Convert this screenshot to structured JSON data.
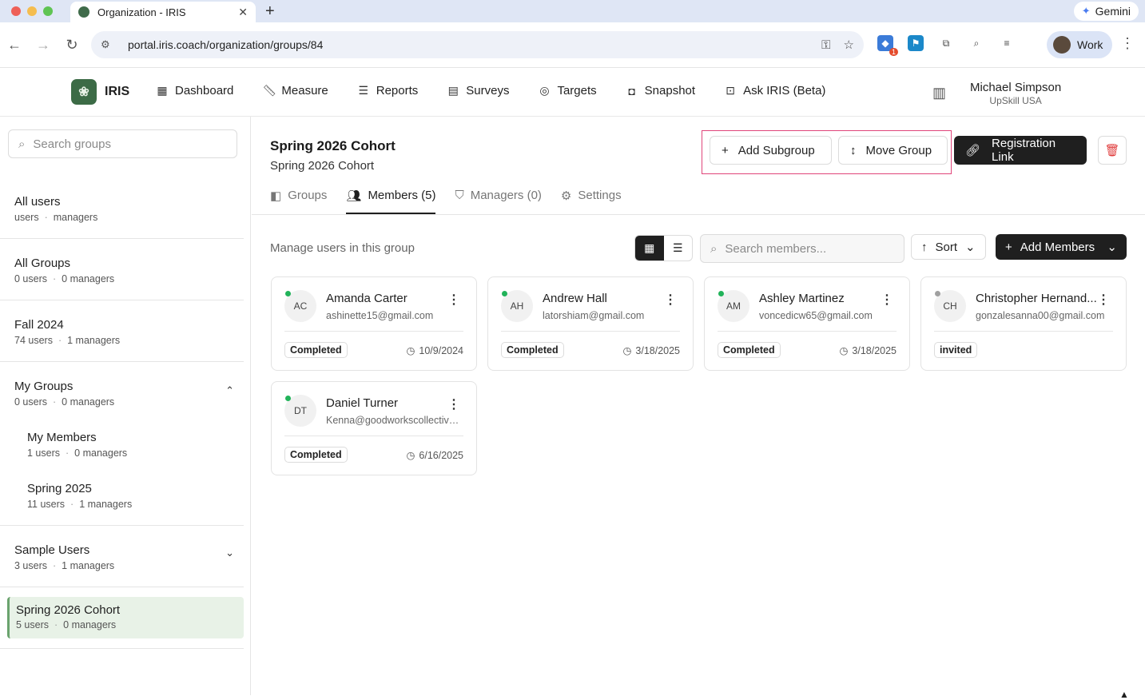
{
  "browser": {
    "tab_title": "Organization - IRIS",
    "url": "portal.iris.coach/organization/groups/84",
    "gemini_label": "Gemini",
    "profile_label": "Work",
    "ext_badge": "1"
  },
  "app": {
    "logo_text": "IRIS",
    "nav": [
      "Dashboard",
      "Measure",
      "Reports",
      "Surveys",
      "Targets",
      "Snapshot",
      "Ask IRIS (Beta)"
    ],
    "user_name": "Michael Simpson",
    "user_org": "UpSkill USA"
  },
  "sidebar": {
    "search_placeholder": "Search groups",
    "groups": [
      {
        "name": "All users",
        "users": "users",
        "managers": "managers"
      },
      {
        "name": "All Groups",
        "users": "0 users",
        "managers": "0 managers"
      },
      {
        "name": "Fall 2024",
        "users": "74 users",
        "managers": "1 managers"
      },
      {
        "name": "My Groups",
        "users": "0 users",
        "managers": "0 managers"
      },
      {
        "name": "My Members",
        "users": "1 users",
        "managers": "0 managers"
      },
      {
        "name": "Spring 2025",
        "users": "11 users",
        "managers": "1 managers"
      },
      {
        "name": "Sample Users",
        "users": "3 users",
        "managers": "1 managers"
      },
      {
        "name": "Spring 2026 Cohort",
        "users": "5 users",
        "managers": "0 managers"
      }
    ]
  },
  "main": {
    "title": "Spring 2026 Cohort",
    "subtitle": "Spring 2026 Cohort",
    "add_subgroup": "Add Subgroup",
    "move_group": "Move Group",
    "registration_link": "Registration Link",
    "tabs": [
      "Groups",
      "Members (5)",
      "Managers (0)",
      "Settings"
    ],
    "manage_text": "Manage users in this group",
    "member_search_placeholder": "Search members...",
    "sort_label": "Sort",
    "add_members_label": "Add Members",
    "members": [
      {
        "initials": "AC",
        "name": "Amanda Carter",
        "email": "ashinette15@gmail.com",
        "status": "Completed",
        "date": "10/9/2024",
        "online": "#22b35a"
      },
      {
        "initials": "AH",
        "name": "Andrew Hall",
        "email": "latorshiam@gmail.com",
        "status": "Completed",
        "date": "3/18/2025",
        "online": "#22b35a"
      },
      {
        "initials": "AM",
        "name": "Ashley Martinez",
        "email": "voncedicw65@gmail.com",
        "status": "Completed",
        "date": "3/18/2025",
        "online": "#22b35a"
      },
      {
        "initials": "CH",
        "name": "Christopher Hernand...",
        "email": "gonzalesanna00@gmail.com",
        "status": "invited",
        "date": "",
        "online": "#a0a0a0"
      },
      {
        "initials": "DT",
        "name": "Daniel Turner",
        "email": "Kenna@goodworkscollective....",
        "status": "Completed",
        "date": "6/16/2025",
        "online": "#22b35a"
      }
    ]
  }
}
